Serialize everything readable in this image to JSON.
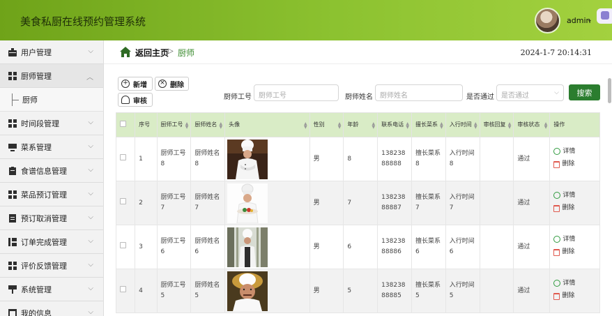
{
  "header": {
    "title": "美食私厨在线预约管理系统",
    "username": "admin"
  },
  "sidebar": {
    "items": [
      {
        "label": "用户管理",
        "icon": "briefcase-icon",
        "expanded": false
      },
      {
        "label": "厨师管理",
        "icon": "grid-icon",
        "expanded": true,
        "sub": [
          "厨师"
        ]
      },
      {
        "label": "时间段管理",
        "icon": "grid-icon",
        "expanded": false
      },
      {
        "label": "菜系管理",
        "icon": "monitor-icon",
        "expanded": false
      },
      {
        "label": "食谱信息管理",
        "icon": "clipboard-icon",
        "expanded": false
      },
      {
        "label": "菜品预订管理",
        "icon": "grid-icon",
        "expanded": false
      },
      {
        "label": "预订取消管理",
        "icon": "document-icon",
        "expanded": false
      },
      {
        "label": "订单完成管理",
        "icon": "columns-icon",
        "expanded": false
      },
      {
        "label": "评价反馈管理",
        "icon": "grid-icon",
        "expanded": false
      },
      {
        "label": "系统管理",
        "icon": "signpost-icon",
        "expanded": false
      },
      {
        "label": "我的信息",
        "icon": "window-icon",
        "expanded": false
      }
    ]
  },
  "breadcrumb": {
    "home": "返回主页",
    "separator": "▷",
    "current": "厨师"
  },
  "datetime": "2024-1-7 20:14:31",
  "toolbar": {
    "add": "新增",
    "delete": "删除",
    "review": "审核"
  },
  "filters": {
    "chef_no_label": "厨师工号",
    "chef_no_placeholder": "厨师工号",
    "chef_name_label": "厨师姓名",
    "chef_name_placeholder": "厨师姓名",
    "approved_label": "是否通过",
    "approved_placeholder": "是否通过",
    "search": "搜索"
  },
  "table": {
    "columns": [
      "序号",
      "厨师工号",
      "厨师姓名",
      "头像",
      "性别",
      "年龄",
      "联系电话",
      "擅长菜系",
      "入行时间",
      "审核回复",
      "审核状态",
      "操作"
    ],
    "detail_label": "详情",
    "delete_label": "删除",
    "rows": [
      {
        "index": "1",
        "chef_no": "厨师工号8",
        "chef_name": "厨师姓名8",
        "gender": "男",
        "age": "8",
        "phone": "13823888888",
        "cuisine": "擅长菜系8",
        "start_time": "入行时间8",
        "reply": "",
        "status": "通过"
      },
      {
        "index": "2",
        "chef_no": "厨师工号7",
        "chef_name": "厨师姓名7",
        "gender": "男",
        "age": "7",
        "phone": "13823888887",
        "cuisine": "擅长菜系7",
        "start_time": "入行时间7",
        "reply": "",
        "status": "通过"
      },
      {
        "index": "3",
        "chef_no": "厨师工号6",
        "chef_name": "厨师姓名6",
        "gender": "男",
        "age": "6",
        "phone": "13823888886",
        "cuisine": "擅长菜系6",
        "start_time": "入行时间6",
        "reply": "",
        "status": "通过"
      },
      {
        "index": "4",
        "chef_no": "厨师工号5",
        "chef_name": "厨师姓名5",
        "gender": "男",
        "age": "5",
        "phone": "13823888885",
        "cuisine": "擅长菜系5",
        "start_time": "入行时间5",
        "reply": "",
        "status": "通过"
      }
    ]
  },
  "colors": {
    "accent": "#8cc230",
    "header_row": "#d9ecc6",
    "search_button": "#2b7d2f",
    "breadcrumb_current": "#3a8a2e"
  }
}
